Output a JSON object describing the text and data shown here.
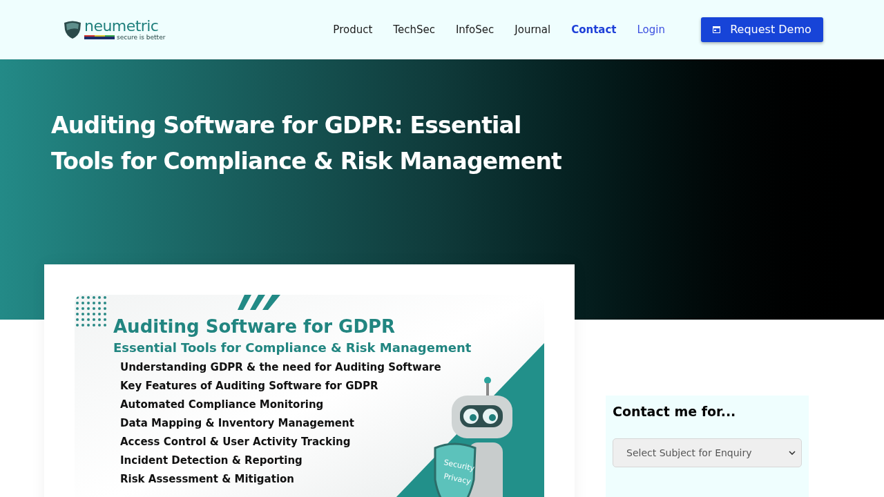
{
  "header": {
    "logo": {
      "name": "neumetric",
      "tagline": "secure is better"
    },
    "nav": [
      {
        "label": "Product",
        "selected": false,
        "kind": "menu"
      },
      {
        "label": "TechSec",
        "selected": false,
        "kind": "menu"
      },
      {
        "label": "InfoSec",
        "selected": false,
        "kind": "menu"
      },
      {
        "label": "Journal",
        "selected": false,
        "kind": "menu"
      },
      {
        "label": "Contact",
        "selected": true,
        "kind": "menu"
      },
      {
        "label": "Login",
        "selected": false,
        "kind": "link"
      }
    ],
    "cta": "Request Demo"
  },
  "hero": {
    "title": "Auditing Software for GDPR: Essential Tools for Compliance & Risk Management"
  },
  "featured_image": {
    "title": "Auditing Software for GDPR",
    "subtitle": "Essential Tools for Compliance & Risk Management",
    "topics": [
      "Understanding GDPR & the need for Auditing Software",
      "Key Features of Auditing Software for GDPR",
      "Automated Compliance Monitoring",
      "Data Mapping & Inventory Management",
      "Access Control & User Activity Tracking",
      "Incident Detection & Reporting",
      "Risk Assessment & Mitigation"
    ],
    "shield_words": [
      "Security",
      "Privacy"
    ]
  },
  "sidebar": {
    "title": "Contact me for...",
    "select": {
      "placeholder": "Select Subject for Enquiry"
    }
  }
}
